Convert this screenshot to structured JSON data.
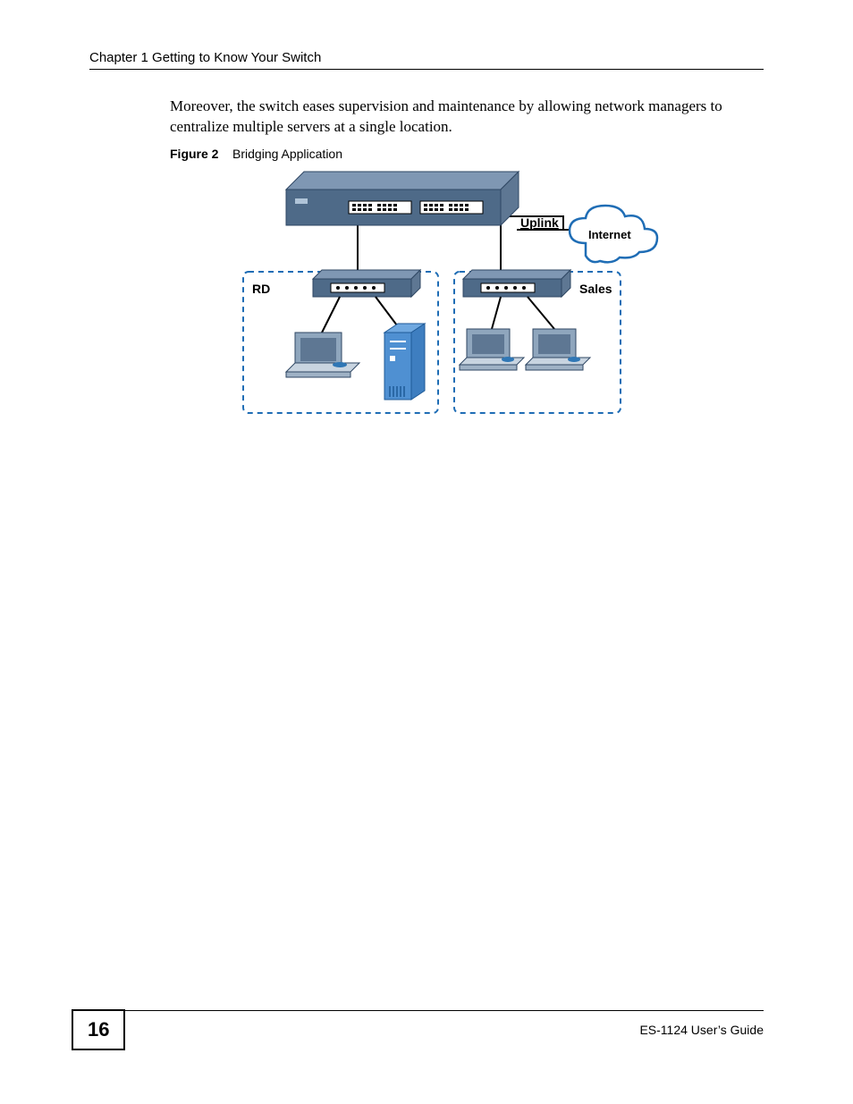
{
  "header": {
    "chapter": "Chapter 1 Getting to Know Your Switch"
  },
  "paragraph": "Moreover, the switch eases supervision and maintenance by allowing network managers to centralize multiple servers at a single location.",
  "figure": {
    "label": "Figure 2",
    "title": "Bridging Application",
    "labels": {
      "uplink": "Uplink",
      "internet": "Internet",
      "rd": "RD",
      "sales": "Sales"
    }
  },
  "footer": {
    "page": "16",
    "guide": "ES-1124 User’s Guide"
  }
}
